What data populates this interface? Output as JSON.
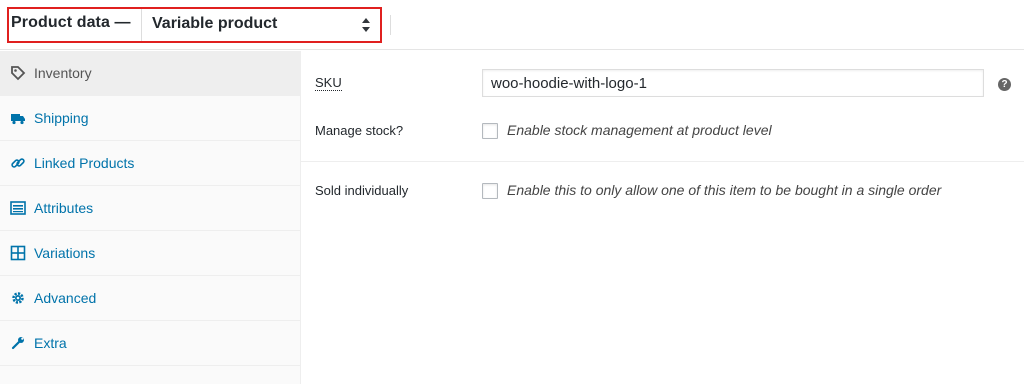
{
  "header": {
    "title": "Product data —",
    "product_type": "Variable product",
    "highlight_color": "#e0201f"
  },
  "sidebar": {
    "items": [
      {
        "label": "Inventory",
        "icon": "tag-icon",
        "active": true
      },
      {
        "label": "Shipping",
        "icon": "truck-icon",
        "active": false
      },
      {
        "label": "Linked Products",
        "icon": "link-icon",
        "active": false
      },
      {
        "label": "Attributes",
        "icon": "list-icon",
        "active": false
      },
      {
        "label": "Variations",
        "icon": "grid-icon",
        "active": false
      },
      {
        "label": "Advanced",
        "icon": "gear-icon",
        "active": false
      },
      {
        "label": "Extra",
        "icon": "wrench-icon",
        "active": false
      }
    ]
  },
  "inventory": {
    "sku_label": "SKU",
    "sku_value": "woo-hoodie-with-logo-1",
    "help_glyph": "?",
    "manage_stock_label": "Manage stock?",
    "manage_stock_desc": "Enable stock management at product level",
    "manage_stock_checked": false,
    "sold_individually_label": "Sold individually",
    "sold_individually_desc": "Enable this to only allow one of this item to be bought in a single order",
    "sold_individually_checked": false
  },
  "colors": {
    "link": "#0073aa",
    "active_tab_bg": "#eeeeee"
  }
}
